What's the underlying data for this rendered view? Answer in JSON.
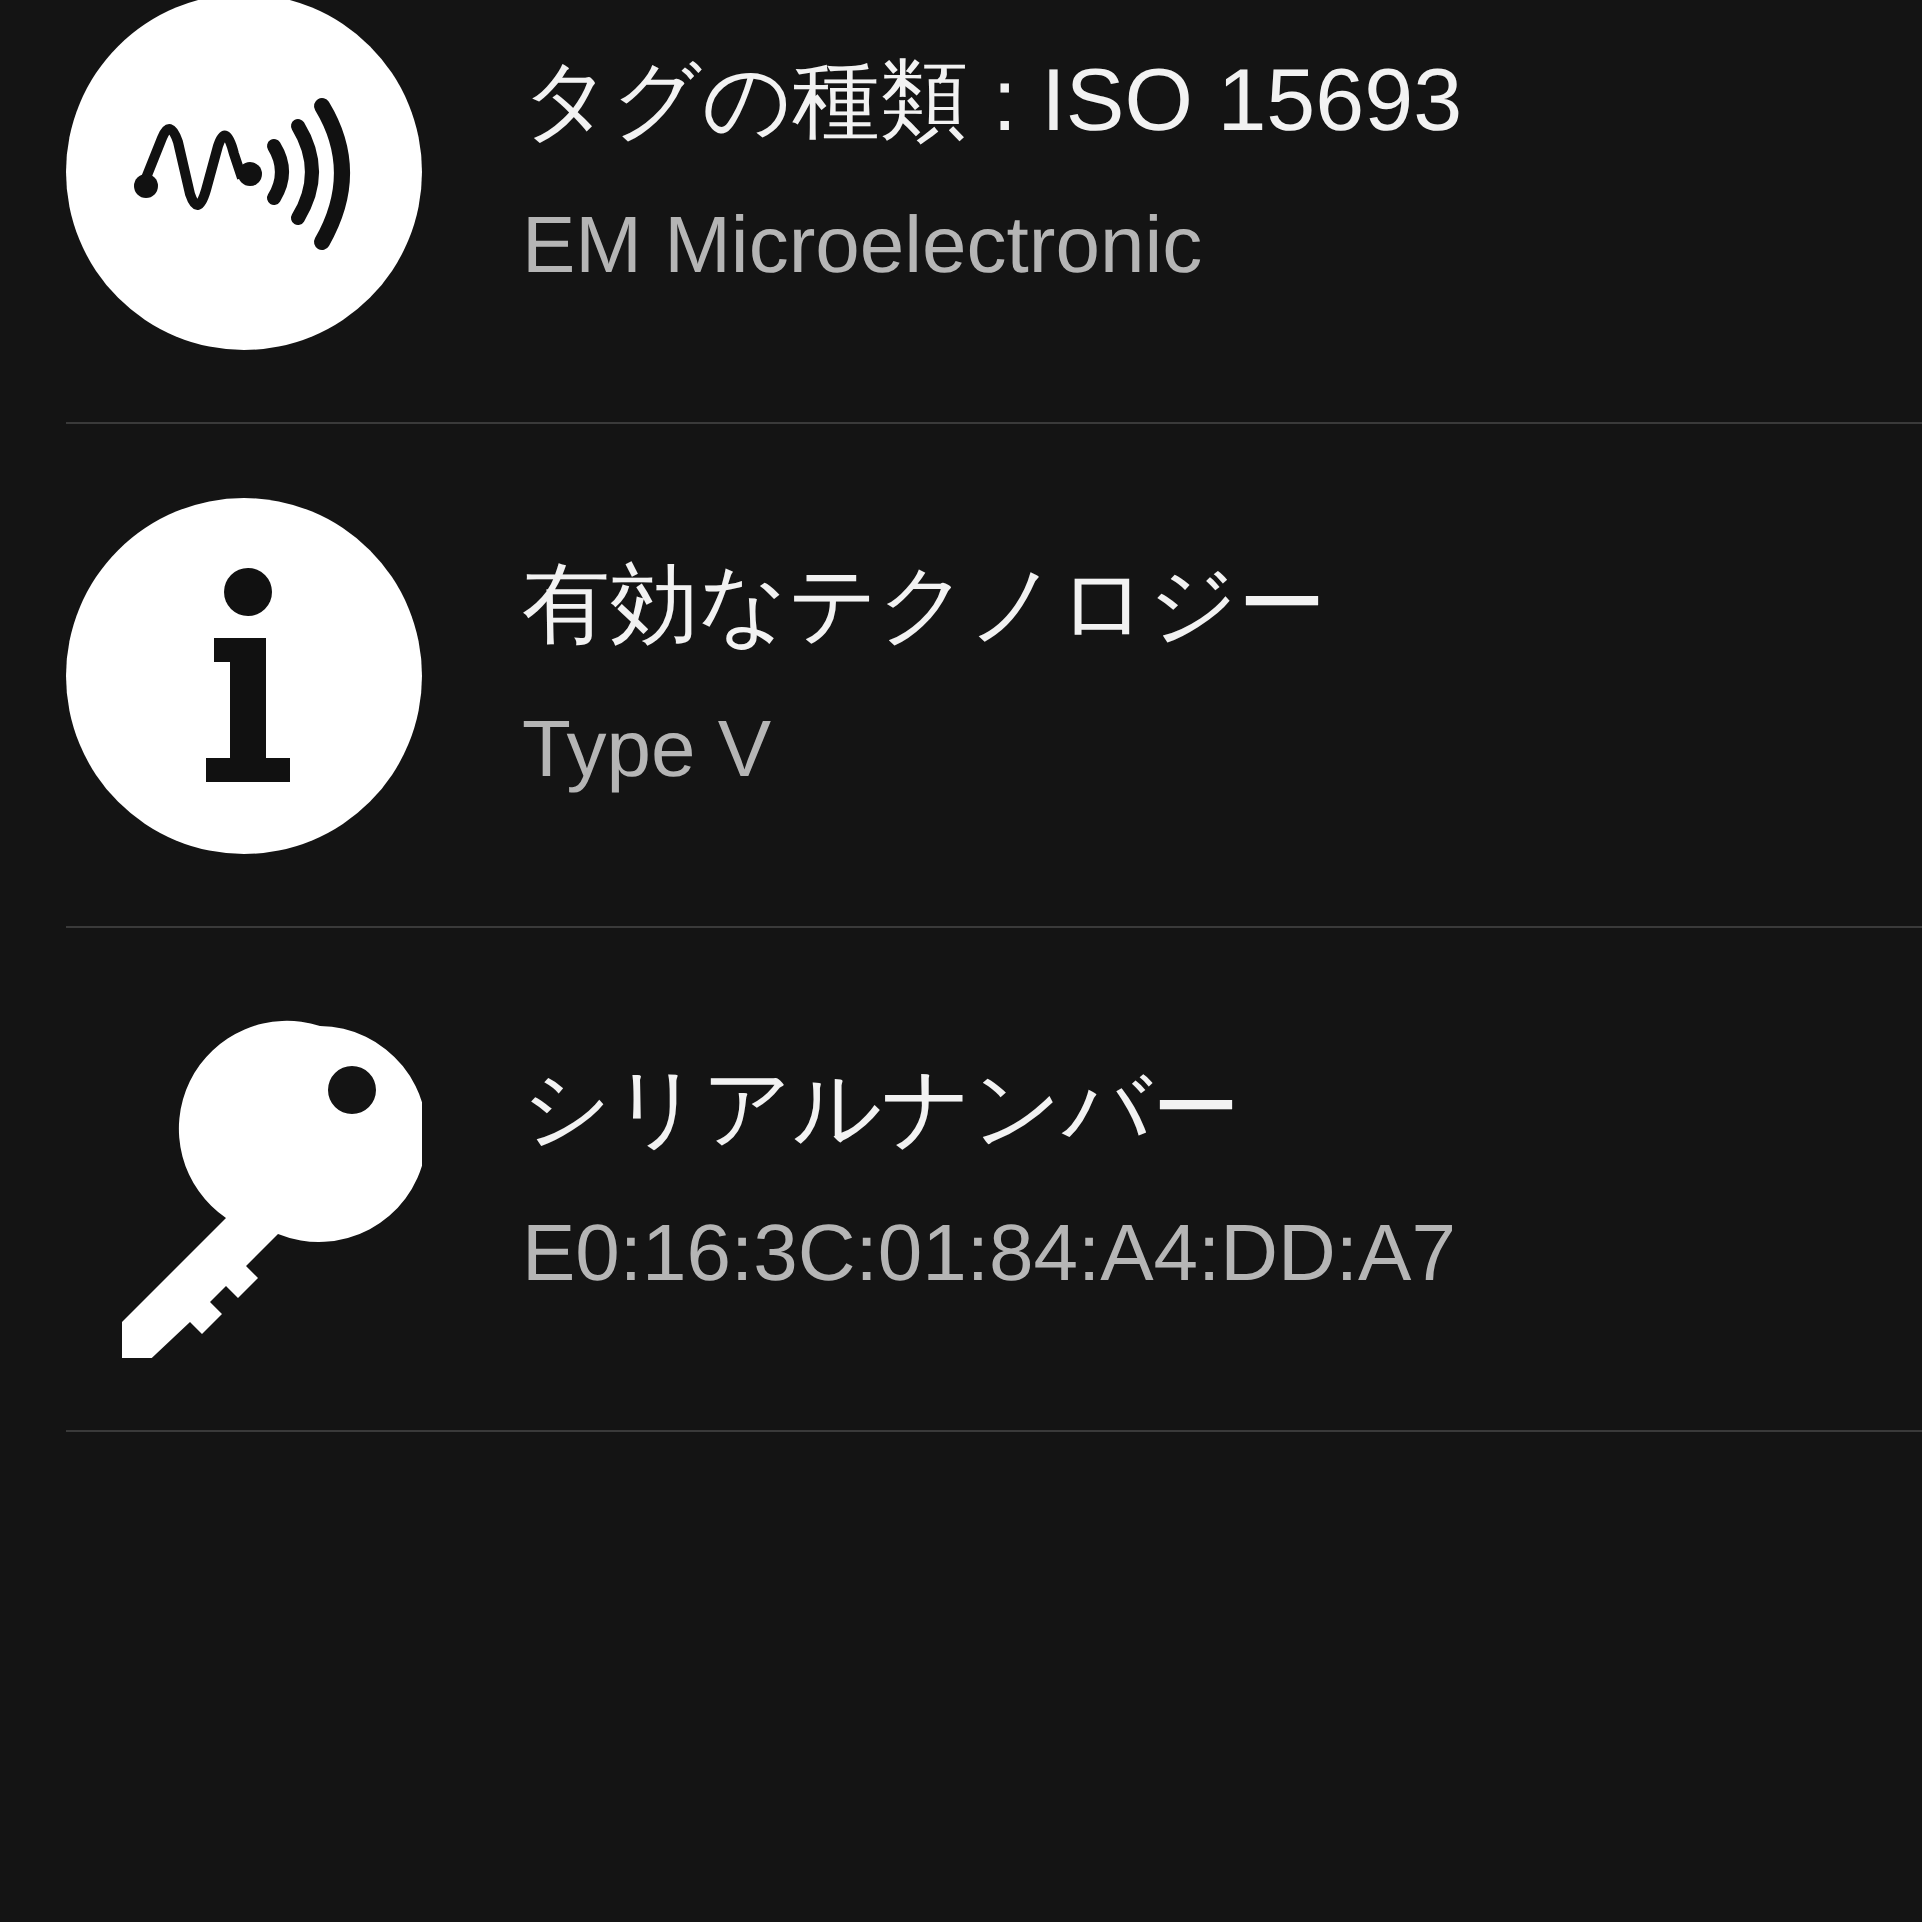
{
  "rows": [
    {
      "kind": "nfc",
      "title": "タグの種類 : ISO 15693",
      "value": "EM Microelectronic"
    },
    {
      "kind": "info",
      "title": "有効なテクノロジー",
      "value": "Type V"
    },
    {
      "kind": "key",
      "title": "シリアルナンバー",
      "value": "E0:16:3C:01:84:A4:DD:A7"
    }
  ]
}
